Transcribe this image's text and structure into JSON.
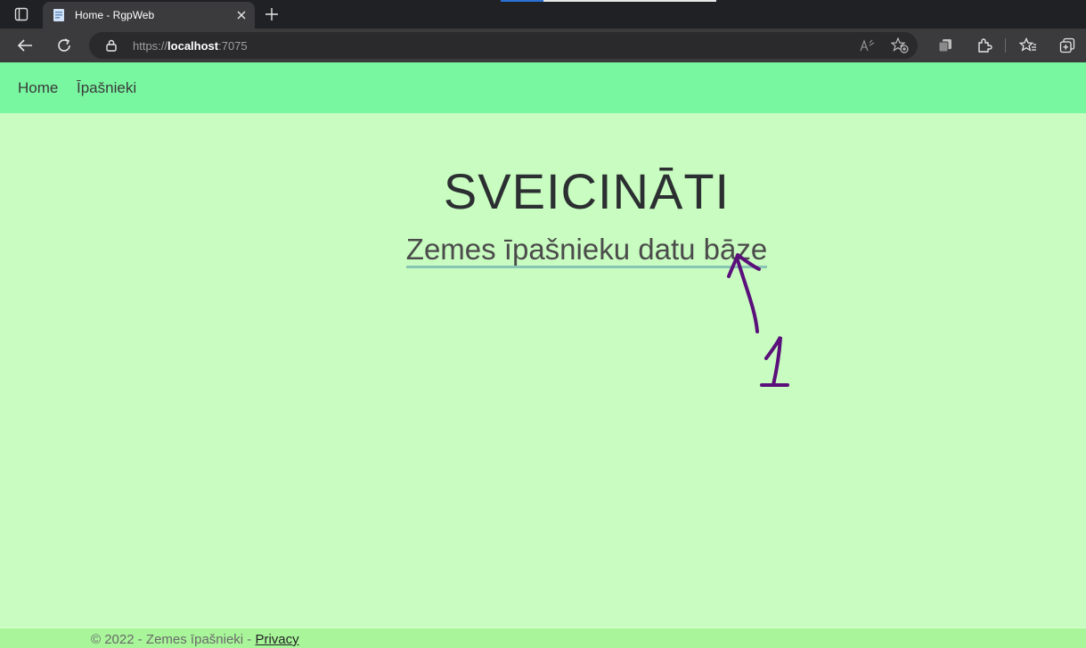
{
  "browser": {
    "tab_title": "Home - RgpWeb",
    "url_scheme": "https://",
    "url_host": "localhost",
    "url_port": ":7075",
    "icons": [
      "tab-actions-icon",
      "favicon-icon",
      "close-icon",
      "new-tab-icon",
      "back-icon",
      "refresh-icon",
      "lock-icon",
      "read-aloud-icon",
      "add-favorite-icon",
      "collections-icon",
      "extensions-icon",
      "favorites-icon",
      "copilot-icon"
    ]
  },
  "nav": {
    "home": "Home",
    "owners": "Īpašnieki"
  },
  "main": {
    "welcome": "SVEICINĀTI",
    "db_link": "Zemes īpašnieku datu bāze"
  },
  "annotation": {
    "number": "1",
    "color": "#5a0f7a"
  },
  "footer": {
    "text": "© 2022 - Zemes īpašnieki - ",
    "privacy": "Privacy"
  },
  "colors": {
    "navbar": "#78f6a0",
    "page_bg": "#c8fcc0",
    "footer_bg": "#a8f59a",
    "link_underline": "#88c5b3"
  }
}
